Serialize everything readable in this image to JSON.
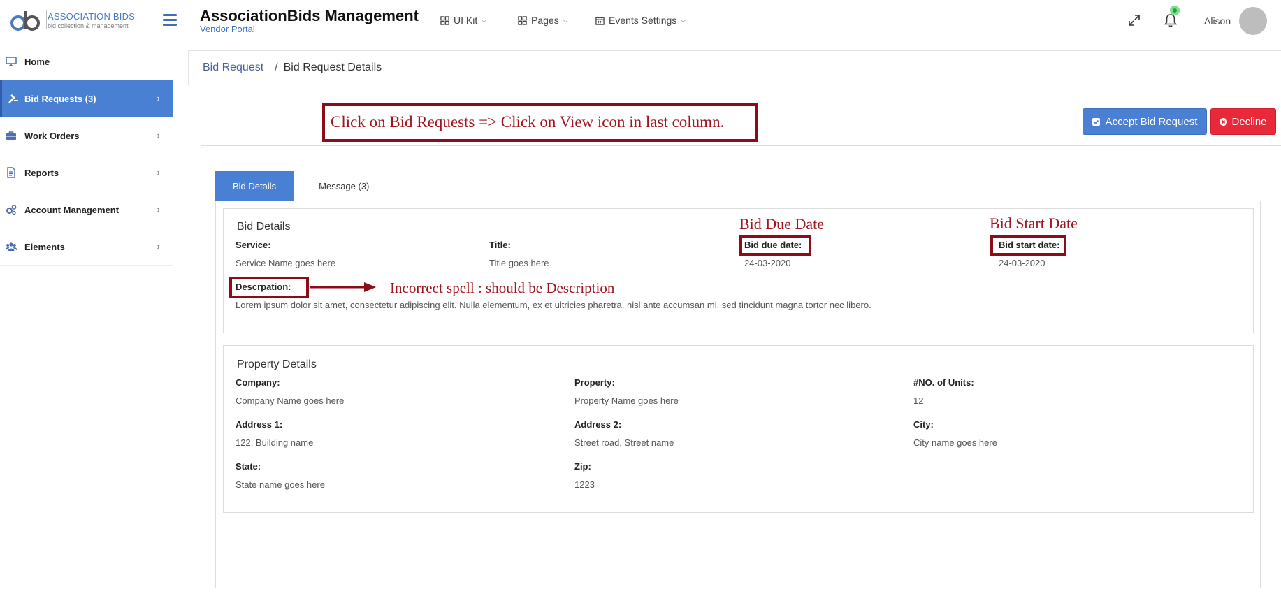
{
  "brand": {
    "logo_primary": "ASSOCIATION BIDS",
    "logo_secondary": "bid collection & management",
    "app_title": "AssociationBids Management",
    "app_subtitle": "Vendor Portal"
  },
  "topnav": {
    "items": [
      {
        "label": "UI Kit",
        "icon": "grid-icon"
      },
      {
        "label": "Pages",
        "icon": "grid-icon"
      },
      {
        "label": "Events Settings",
        "icon": "calendar-icon"
      }
    ],
    "user_name": "Alison",
    "notification_status_color": "#2c9d43"
  },
  "sidebar": {
    "items": [
      {
        "label": "Home",
        "icon": "monitor-icon",
        "active": false
      },
      {
        "label": "Bid Requests (3)",
        "icon": "gavel-icon",
        "active": true
      },
      {
        "label": "Work Orders",
        "icon": "briefcase-icon",
        "active": false
      },
      {
        "label": "Reports",
        "icon": "document-icon",
        "active": false
      },
      {
        "label": "Account Management",
        "icon": "gears-icon",
        "active": false
      },
      {
        "label": "Elements",
        "icon": "users-icon",
        "active": false
      }
    ]
  },
  "breadcrumb": {
    "parent": "Bid Request",
    "separator": "/",
    "current": "Bid Request Details"
  },
  "actions": {
    "accept_label": "Accept Bid Request",
    "decline_label": "Decline",
    "accept_color": "#4a80d3",
    "decline_color": "#e8293a"
  },
  "tabs": [
    {
      "label": "Bid Details",
      "active": true
    },
    {
      "label": "Message (3)",
      "active": false
    }
  ],
  "bid_details": {
    "title": "Bid Details",
    "service_label": "Service:",
    "service_value": "Service Name goes here",
    "title_label": "Title:",
    "title_value": "Title goes here",
    "due_label": "Bid due date:",
    "due_value": "24-03-2020",
    "start_label": "Bid start date:",
    "start_value": "24-03-2020",
    "description_label": "Descrpation:",
    "description_value": "Lorem ipsum dolor sit amet, consectetur adipiscing elit. Nulla elementum, ex et ultricies pharetra, nisl ante accumsan mi, sed tincidunt magna tortor nec libero."
  },
  "property_details": {
    "title": "Property Details",
    "fields": [
      {
        "label": "Company:",
        "value": "Company Name goes here"
      },
      {
        "label": "Property:",
        "value": "Property Name goes here"
      },
      {
        "label": "#NO. of Units:",
        "value": "12"
      },
      {
        "label": "Address 1:",
        "value": "122, Building name"
      },
      {
        "label": "Address 2:",
        "value": "Street road, Street name"
      },
      {
        "label": "City:",
        "value": "City name goes here"
      },
      {
        "label": "State:",
        "value": "State name goes here"
      },
      {
        "label": "Zip:",
        "value": "1223"
      }
    ]
  },
  "annotations": {
    "instruction": "Click on Bid Requests => Click on View icon in last column.",
    "due_note": "Bid Due Date",
    "start_note": "Bid Start Date",
    "spelling_note": "Incorrect spell : should be Description",
    "color": "#8a0d17"
  }
}
